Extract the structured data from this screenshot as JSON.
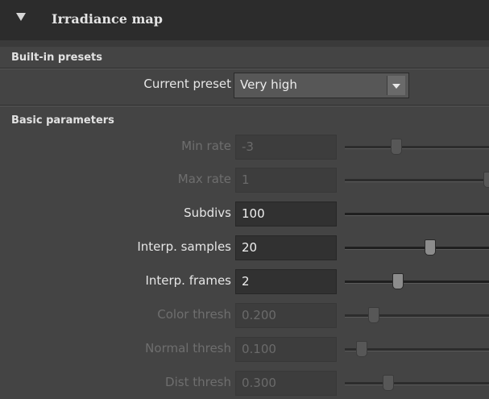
{
  "rollout": {
    "title": "Irradiance map"
  },
  "presets": {
    "section_title": "Built-in presets",
    "current_preset_label": "Current preset",
    "current_preset_value": "Very high"
  },
  "basic": {
    "section_title": "Basic parameters",
    "rows": [
      {
        "label": "Min rate",
        "value": "-3",
        "enabled": false,
        "slider_fraction": 0.36
      },
      {
        "label": "Max rate",
        "value": "1",
        "enabled": false,
        "slider_fraction": 1.0
      },
      {
        "label": "Subdivs",
        "value": "100",
        "enabled": true,
        "slider_fraction": null
      },
      {
        "label": "Interp. samples",
        "value": "20",
        "enabled": true,
        "slider_fraction": 0.59
      },
      {
        "label": "Interp. frames",
        "value": "2",
        "enabled": true,
        "slider_fraction": 0.37
      },
      {
        "label": "Color thresh",
        "value": "0.200",
        "enabled": false,
        "slider_fraction": 0.2
      },
      {
        "label": "Normal thresh",
        "value": "0.100",
        "enabled": false,
        "slider_fraction": 0.12
      },
      {
        "label": "Dist thresh",
        "value": "0.300",
        "enabled": false,
        "slider_fraction": 0.3
      }
    ]
  },
  "colors": {
    "panel": "#444444",
    "header": "#2c2c2c",
    "text_enabled": "#e6e6e6",
    "text_disabled": "#6e6e6e"
  }
}
